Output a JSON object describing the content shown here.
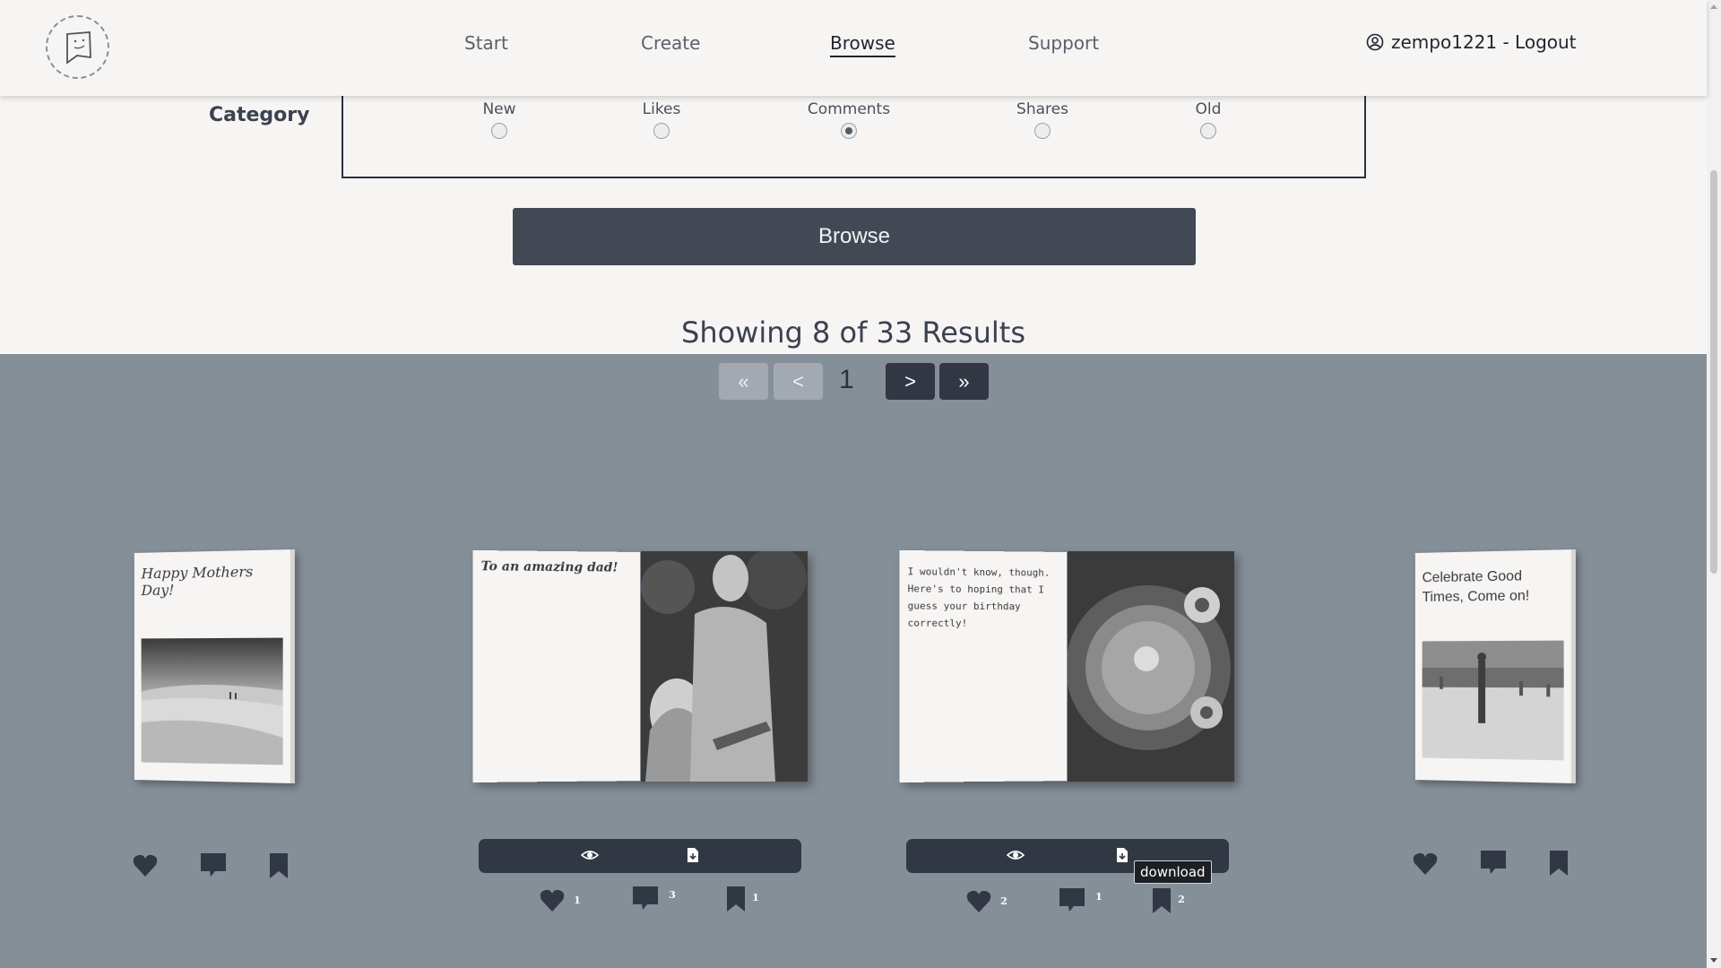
{
  "nav": {
    "links": [
      {
        "label": "Start"
      },
      {
        "label": "Create"
      },
      {
        "label": "Browse",
        "active": true
      },
      {
        "label": "Support"
      }
    ],
    "user_label": "zempo1221 - Logout"
  },
  "filter": {
    "title": "Category",
    "options": [
      {
        "label": "New",
        "checked": false
      },
      {
        "label": "Likes",
        "checked": false
      },
      {
        "label": "Comments",
        "checked": true
      },
      {
        "label": "Shares",
        "checked": false
      },
      {
        "label": "Old",
        "checked": false
      }
    ],
    "browse_button": "Browse"
  },
  "results": {
    "summary": "Showing 8 of 33 Results"
  },
  "pager": {
    "first": "«",
    "prev": "<",
    "current": "1",
    "next": ">",
    "last": "»"
  },
  "cards": [
    {
      "text": "Happy Mothers Day!",
      "state": "closed",
      "likes": "",
      "comments": "",
      "saves": ""
    },
    {
      "text": "To an amazing dad!",
      "state": "open",
      "likes": "1",
      "comments": "3",
      "saves": "1"
    },
    {
      "text": "I wouldn't know, though. Here's to hoping that I guess your birthday correctly!",
      "state": "open",
      "likes": "2",
      "comments": "1",
      "saves": "2"
    },
    {
      "text": "Celebrate Good Times, Come on!",
      "state": "closed",
      "likes": "",
      "comments": "",
      "saves": ""
    }
  ],
  "tooltip": "download",
  "colors": {
    "accent_dark": "#323843",
    "gallery_bg": "#858f98",
    "page_bg": "#f7f5f4"
  }
}
